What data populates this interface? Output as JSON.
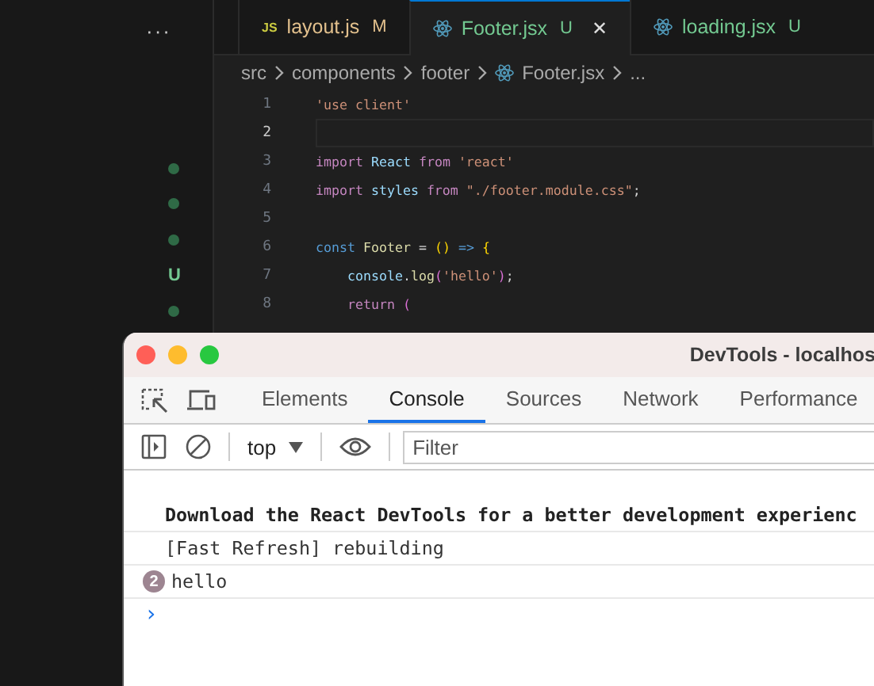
{
  "sidebar": {
    "more": "···",
    "badges": [
      {
        "kind": "dot"
      },
      {
        "kind": "dot"
      },
      {
        "kind": "dot"
      },
      {
        "kind": "letter",
        "text": "U"
      },
      {
        "kind": "dot"
      }
    ]
  },
  "tabs": [
    {
      "kind": "js",
      "icon_text": "JS",
      "label": "layout.js",
      "status": "M",
      "color": "#e2c08d",
      "selected": false,
      "close": false
    },
    {
      "kind": "react",
      "label": "Footer.jsx",
      "status": "U",
      "color": "#73c991",
      "selected": true,
      "close": true,
      "close_text": "✕"
    },
    {
      "kind": "react",
      "label": "loading.jsx",
      "status": "U",
      "color": "#73c991",
      "selected": false,
      "close": false
    }
  ],
  "breadcrumb": [
    {
      "kind": "folder",
      "text": "src"
    },
    {
      "kind": "folder",
      "text": "components"
    },
    {
      "kind": "folder",
      "text": "footer"
    },
    {
      "kind": "react",
      "text": "Footer.jsx"
    },
    {
      "kind": "folder",
      "text": "..."
    }
  ],
  "code": [
    {
      "number": "1",
      "current": false,
      "tokens": [
        {
          "t": "'use client'",
          "color": "#ce9178"
        }
      ]
    },
    {
      "number": "2",
      "current": true
    },
    {
      "number": "3",
      "current": false,
      "tokens": [
        {
          "t": "import ",
          "color": "#c586c0"
        },
        {
          "t": "React ",
          "color": "#9cdcfe"
        },
        {
          "t": "from ",
          "color": "#c586c0"
        },
        {
          "t": "'react'",
          "color": "#ce9178"
        }
      ]
    },
    {
      "number": "4",
      "current": false,
      "tokens": [
        {
          "t": "import ",
          "color": "#c586c0"
        },
        {
          "t": "styles ",
          "color": "#9cdcfe"
        },
        {
          "t": "from ",
          "color": "#c586c0"
        },
        {
          "t": "\"./footer.module.css\"",
          "color": "#ce9178"
        },
        {
          "t": ";",
          "color": "#d4d4d4"
        }
      ]
    },
    {
      "number": "5",
      "current": false
    },
    {
      "number": "6",
      "current": false,
      "tokens": [
        {
          "t": "const ",
          "color": "#569cd6"
        },
        {
          "t": "Footer ",
          "color": "#dcdcaa"
        },
        {
          "t": "= ",
          "color": "#d4d4d4"
        },
        {
          "t": "() ",
          "color": "#ffd700"
        },
        {
          "t": "=> ",
          "color": "#569cd6"
        },
        {
          "t": "{",
          "color": "#ffd700"
        }
      ]
    },
    {
      "number": "7",
      "current": false,
      "tokens": [
        {
          "t": "    console",
          "color": "#9cdcfe"
        },
        {
          "t": ".",
          "color": "#d4d4d4"
        },
        {
          "t": "log",
          "color": "#dcdcaa"
        },
        {
          "t": "(",
          "color": "#da70d6"
        },
        {
          "t": "'hello'",
          "color": "#ce9178"
        },
        {
          "t": ")",
          "color": "#da70d6"
        },
        {
          "t": ";",
          "color": "#d4d4d4"
        }
      ]
    },
    {
      "number": "8",
      "current": false,
      "tokens": [
        {
          "t": "    return ",
          "color": "#c586c0"
        },
        {
          "t": "(",
          "color": "#da70d6"
        }
      ]
    }
  ],
  "devtools": {
    "title": "DevTools - localhos",
    "tabs": [
      {
        "label": "Elements",
        "selected": false
      },
      {
        "label": "Console",
        "selected": true
      },
      {
        "label": "Sources",
        "selected": false
      },
      {
        "label": "Network",
        "selected": false
      },
      {
        "label": "Performance",
        "selected": false
      }
    ],
    "context": "top",
    "filter": {
      "placeholder": "Filter"
    },
    "messages": [
      {
        "kind": "bold",
        "text": "Download the React DevTools for a better development experienc"
      },
      {
        "kind": "plain",
        "text": "[Fast Refresh] rebuilding"
      },
      {
        "kind": "repeated",
        "count": "2",
        "text": "hello"
      }
    ],
    "prompt": "›"
  }
}
